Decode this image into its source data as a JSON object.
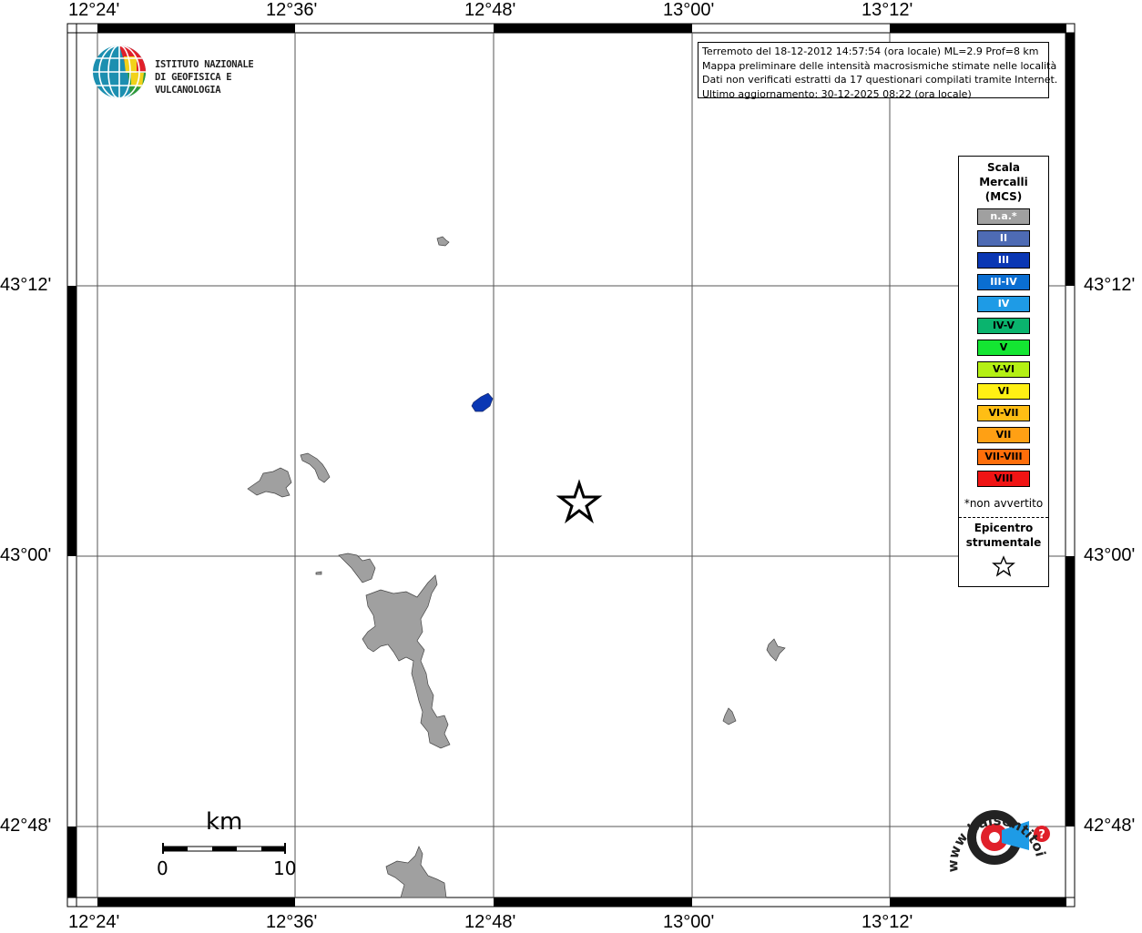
{
  "info": {
    "line1": "Terremoto del 18-12-2012 14:57:54 (ora locale) ML=2.9 Prof=8 km",
    "line2": "Mappa preliminare delle intensità macrosismiche stimate nelle località",
    "line3": "Dati non verificati estratti da 17 questionari compilati tramite Internet.",
    "line4": "Ultimo aggiornamento: 30-12-2025 08:22 (ora locale)"
  },
  "ingv": {
    "line1": "ISTITUTO NAZIONALE",
    "line2": "DI GEOFISICA E VULCANOLOGIA"
  },
  "axes": {
    "lon_labels": [
      "12°24'",
      "12°36'",
      "12°48'",
      "13°00'",
      "13°12'"
    ],
    "lat_labels": [
      "43°12'",
      "43°00'",
      "42°48'"
    ]
  },
  "legend": {
    "title_l1": "Scala",
    "title_l2": "Mercalli",
    "title_l3": "(MCS)",
    "items": [
      {
        "label": "n.a.*",
        "color": "#a0a0a0",
        "text": "#ffffff"
      },
      {
        "label": "II",
        "color": "#4e6bb4",
        "text": "#ffffff"
      },
      {
        "label": "III",
        "color": "#0a37b4",
        "text": "#ffffff"
      },
      {
        "label": "III-IV",
        "color": "#0a6ed2",
        "text": "#ffffff"
      },
      {
        "label": "IV",
        "color": "#1e9be6",
        "text": "#ffffff"
      },
      {
        "label": "IV-V",
        "color": "#0ab46e",
        "text": "#000000"
      },
      {
        "label": "V",
        "color": "#14e632",
        "text": "#000000"
      },
      {
        "label": "V-VI",
        "color": "#b4f014",
        "text": "#000000"
      },
      {
        "label": "VI",
        "color": "#fff014",
        "text": "#000000"
      },
      {
        "label": "VI-VII",
        "color": "#ffbe14",
        "text": "#000000"
      },
      {
        "label": "VII",
        "color": "#ffa014",
        "text": "#000000"
      },
      {
        "label": "VII-VIII",
        "color": "#ff6e0a",
        "text": "#000000"
      },
      {
        "label": "VIII",
        "color": "#f01414",
        "text": "#000000"
      }
    ],
    "note": "*non avvertito",
    "epi_l1": "Epicentro",
    "epi_l2": "strumentale"
  },
  "scale_bar": {
    "unit": "km",
    "min": "0",
    "max": "10"
  },
  "hsi": {
    "text": "www.haisentitoilterremoto.it"
  },
  "features": {
    "epicenter": {
      "lon": 12.868,
      "lat": 43.035
    },
    "locality_color_na": "#a0a0a0",
    "locality_color_iii": "#0a37b4"
  }
}
